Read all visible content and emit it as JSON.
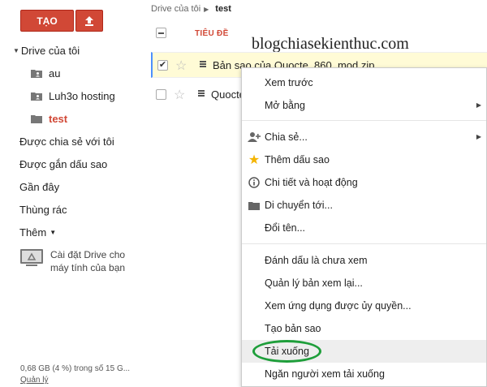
{
  "sidebar": {
    "create_label": "TẠO",
    "nav": [
      {
        "label": "Drive của tôi",
        "type": "root"
      },
      {
        "label": "au",
        "type": "shared-folder"
      },
      {
        "label": "Luh3o hosting",
        "type": "shared-folder"
      },
      {
        "label": "test",
        "type": "folder",
        "active": true
      },
      {
        "label": "Được chia sẻ với tôi",
        "type": "link"
      },
      {
        "label": "Được gắn dấu sao",
        "type": "link"
      },
      {
        "label": "Gần đây",
        "type": "link"
      },
      {
        "label": "Thùng rác",
        "type": "link"
      },
      {
        "label": "Thêm",
        "type": "more"
      }
    ],
    "install_label": "Cài đặt Drive cho máy tính của bạn",
    "storage_text": "0,68 GB (4 %) trong số 15 G...",
    "manage_label": "Quản lý"
  },
  "breadcrumb": {
    "root": "Drive của tôi",
    "current": "test"
  },
  "list": {
    "header_title": "TIÊU ĐỀ",
    "files": [
      {
        "name": "Bản sao của Quocte_860_mod.zip",
        "checked": true
      },
      {
        "name": "Quocte",
        "checked": false
      }
    ]
  },
  "watermark": "blogchiasekienthuc.com",
  "context_menu": {
    "items": [
      {
        "label": "Xem trước",
        "icon": "",
        "submenu": false
      },
      {
        "label": "Mở bằng",
        "icon": "",
        "submenu": true
      },
      {
        "label": "Chia sẻ...",
        "icon": "share-person-icon",
        "submenu": true
      },
      {
        "label": "Thêm dấu sao",
        "icon": "star-icon",
        "submenu": false
      },
      {
        "label": "Chi tiết và hoạt động",
        "icon": "info-icon",
        "submenu": false
      },
      {
        "label": "Di chuyển tới...",
        "icon": "folder-icon",
        "submenu": false
      },
      {
        "label": "Đổi tên...",
        "icon": "",
        "submenu": false
      },
      {
        "label": "Đánh dấu là chưa xem",
        "icon": "",
        "submenu": false
      },
      {
        "label": "Quản lý bản xem lại...",
        "icon": "",
        "submenu": false
      },
      {
        "label": "Xem ứng dụng được ủy quyền...",
        "icon": "",
        "submenu": false
      },
      {
        "label": "Tạo bản sao",
        "icon": "",
        "submenu": false
      },
      {
        "label": "Tải xuống",
        "icon": "",
        "submenu": false,
        "highlighted": true
      },
      {
        "label": "Ngăn người xem tải xuống",
        "icon": "",
        "submenu": false
      }
    ]
  },
  "colors": {
    "accent": "#d14836",
    "highlight_ring": "#1e9e3a",
    "selection": "#fffbd6"
  }
}
